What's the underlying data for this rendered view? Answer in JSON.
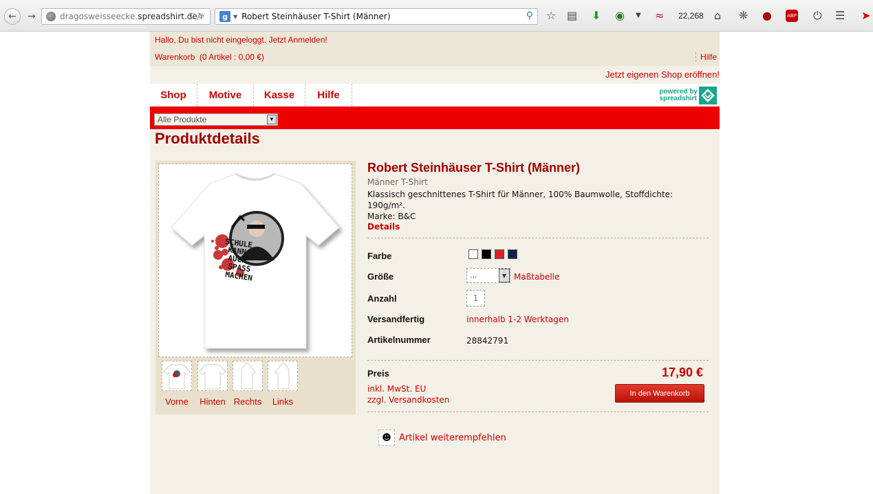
{
  "browser": {
    "url_host_prefix": "dragosweisseecke.",
    "url_host": "spreadshirt.de",
    "url_tail": "/r",
    "search_engine_letter": "g",
    "search_text": "Robert Steinhäuser T-Shirt (Männer)",
    "counter": "22,268"
  },
  "header": {
    "greeting": "Hallo, Du bist nicht eingeloggt.",
    "login_link": "Jetzt Anmelden!",
    "cart_label": "Warenkorb",
    "cart_status": "(0 Artikel : 0,00 €)",
    "help_link": "Hilfe",
    "open_shop_link": "Jetzt eigenen Shop eröffnen!"
  },
  "nav": {
    "tabs": [
      "Shop",
      "Motive",
      "Kasse",
      "Hilfe"
    ],
    "powered_line1": "powered by",
    "powered_line2": "spreadshirt"
  },
  "filter": {
    "category_selected": "Alle Produkte"
  },
  "page_title": "Produktdetails",
  "product": {
    "title": "Robert Steinhäuser T-Shirt (Männer)",
    "subtitle": "Männer T-Shirt",
    "description_line1": "Klassisch geschnittenes T-Shirt für Männer, 100% Baumwolle, Stoffdichte: 190g/m².",
    "description_line2": "Marke: B&C",
    "details_link": "Details",
    "color_label": "Farbe",
    "colors": [
      "#ffffff",
      "#000000",
      "#e02020",
      "#0f2348"
    ],
    "size_label": "Größe",
    "size_selected": "...",
    "size_table_link": "Maßtabelle",
    "quantity_label": "Anzahl",
    "quantity_value": "1",
    "shipping_label": "Versandfertig",
    "shipping_value": "innerhalb 1-2 Werktagen",
    "article_label": "Artikelnummer",
    "article_value": "28842791",
    "price_label": "Preis",
    "price": "17,90 €",
    "tax_note": "inkl. MwSt. EU",
    "shipping_note": "zzgl. Versandkosten",
    "add_to_cart": "In den Warenkorb",
    "recommend": "Artikel weiterempfehlen"
  },
  "image": {
    "print_lines": [
      "SCHULE",
      "KANN",
      "AUCH",
      "SPASS",
      "MACHEN"
    ],
    "thumbnails": [
      "Vorne",
      "Hinten",
      "Rechts",
      "Links"
    ]
  },
  "colors": {
    "accent_red": "#cc0000",
    "banner_red": "#ee0000",
    "page_bg": "#f3f0e7",
    "teal": "#1aa58c"
  }
}
